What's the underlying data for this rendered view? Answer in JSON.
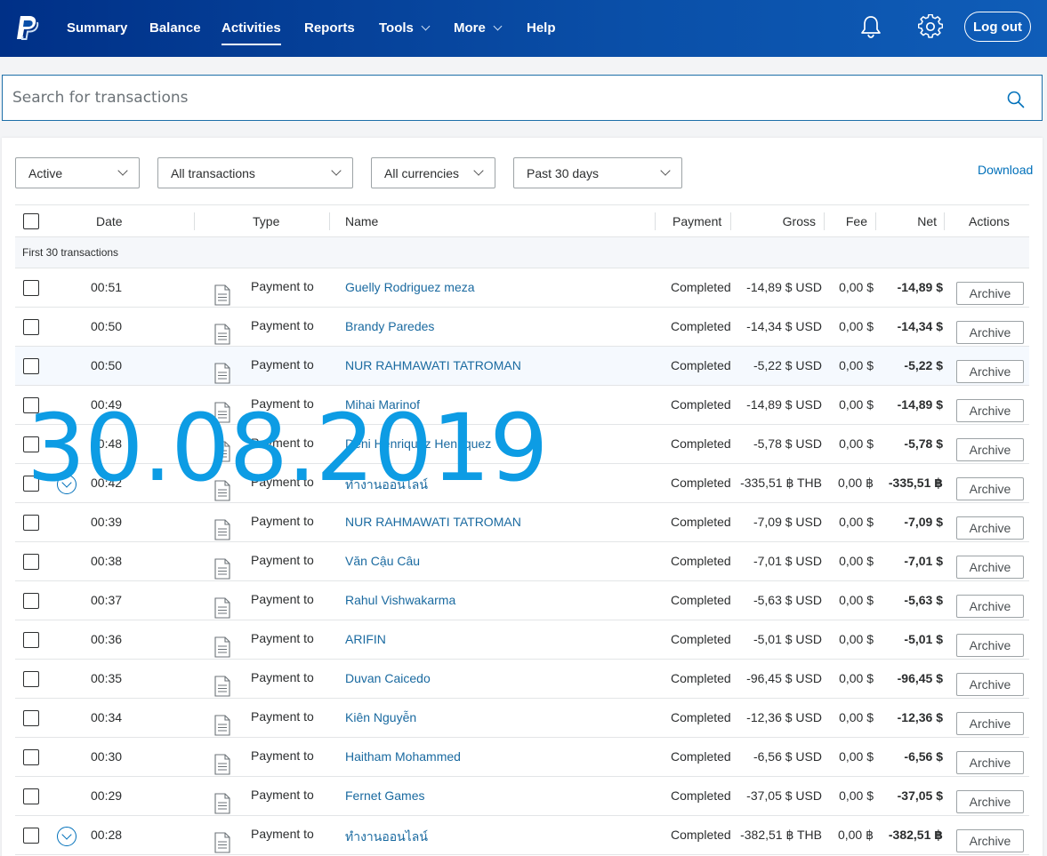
{
  "header": {
    "nav": [
      {
        "label": "Summary"
      },
      {
        "label": "Balance"
      },
      {
        "label": "Activities"
      },
      {
        "label": "Reports"
      },
      {
        "label": "Tools"
      },
      {
        "label": "More"
      },
      {
        "label": "Help"
      }
    ],
    "active_nav": "Activities",
    "logout_label": "Log out",
    "icons": [
      "paypal-logo",
      "bell-icon",
      "gear-icon"
    ]
  },
  "search": {
    "placeholder": "Search for transactions",
    "value": ""
  },
  "filters": {
    "status": "Active",
    "type": "All transactions",
    "currency": "All currencies",
    "period": "Past 30 days",
    "download_label": "Download"
  },
  "table": {
    "headers": {
      "date": "Date",
      "type": "Type",
      "name": "Name",
      "payment": "Payment",
      "gross": "Gross",
      "fee": "Fee",
      "net": "Net",
      "actions": "Actions"
    },
    "subheader": "First 30 transactions",
    "archive_label": "Archive",
    "rows": [
      {
        "time": "00:51",
        "type": "Payment to",
        "name": "Guelly Rodriguez meza",
        "status": "Completed",
        "gross": "-14,89 $ USD",
        "fee": "0,00 $",
        "net": "-14,89 $"
      },
      {
        "time": "00:50",
        "type": "Payment to",
        "name": "Brandy Paredes",
        "status": "Completed",
        "gross": "-14,34 $ USD",
        "fee": "0,00 $",
        "net": "-14,34 $"
      },
      {
        "time": "00:50",
        "type": "Payment to",
        "name": "NUR RAHMAWATI TATROMAN",
        "status": "Completed",
        "gross": "-5,22 $ USD",
        "fee": "0,00 $",
        "net": "-5,22 $"
      },
      {
        "time": "00:49",
        "type": "Payment to",
        "name": "Mihai Marinof",
        "status": "Completed",
        "gross": "-14,89 $ USD",
        "fee": "0,00 $",
        "net": "-14,89 $"
      },
      {
        "time": "00:48",
        "type": "Payment to",
        "name": "Deni Henriquez Henriquez",
        "status": "Completed",
        "gross": "-5,78 $ USD",
        "fee": "0,00 $",
        "net": "-5,78 $"
      },
      {
        "time": "00:42",
        "type": "Payment to",
        "name": "ทำงานออนไลน์",
        "status": "Completed",
        "gross": "-335,51 ฿ THB",
        "fee": "0,00 ฿",
        "net": "-335,51 ฿"
      },
      {
        "time": "00:39",
        "type": "Payment to",
        "name": "NUR RAHMAWATI TATROMAN",
        "status": "Completed",
        "gross": "-7,09 $ USD",
        "fee": "0,00 $",
        "net": "-7,09 $"
      },
      {
        "time": "00:38",
        "type": "Payment to",
        "name": "Văn Cậu Câu",
        "status": "Completed",
        "gross": "-7,01 $ USD",
        "fee": "0,00 $",
        "net": "-7,01 $"
      },
      {
        "time": "00:37",
        "type": "Payment to",
        "name": "Rahul Vishwakarma",
        "status": "Completed",
        "gross": "-5,63 $ USD",
        "fee": "0,00 $",
        "net": "-5,63 $"
      },
      {
        "time": "00:36",
        "type": "Payment to",
        "name": "ARIFIN",
        "status": "Completed",
        "gross": "-5,01 $ USD",
        "fee": "0,00 $",
        "net": "-5,01 $"
      },
      {
        "time": "00:35",
        "type": "Payment to",
        "name": "Duvan Caicedo",
        "status": "Completed",
        "gross": "-96,45 $ USD",
        "fee": "0,00 $",
        "net": "-96,45 $"
      },
      {
        "time": "00:34",
        "type": "Payment to",
        "name": "Kiên Nguyễn",
        "status": "Completed",
        "gross": "-12,36 $ USD",
        "fee": "0,00 $",
        "net": "-12,36 $"
      },
      {
        "time": "00:30",
        "type": "Payment to",
        "name": "Haitham Mohammed",
        "status": "Completed",
        "gross": "-6,56 $ USD",
        "fee": "0,00 $",
        "net": "-6,56 $"
      },
      {
        "time": "00:29",
        "type": "Payment to",
        "name": "Fernet Games",
        "status": "Completed",
        "gross": "-37,05 $ USD",
        "fee": "0,00 $",
        "net": "-37,05 $"
      },
      {
        "time": "00:28",
        "type": "Payment to",
        "name": "ทำงานออนไลน์",
        "status": "Completed",
        "gross": "-382,51 ฿ THB",
        "fee": "0,00 ฿",
        "net": "-382,51 ฿"
      }
    ]
  },
  "overlay": {
    "date_stamp": "30.08.2019"
  },
  "colors": {
    "header_bg": "#003087",
    "link": "#1a6aa0",
    "watermark": "#0d9ce4"
  }
}
